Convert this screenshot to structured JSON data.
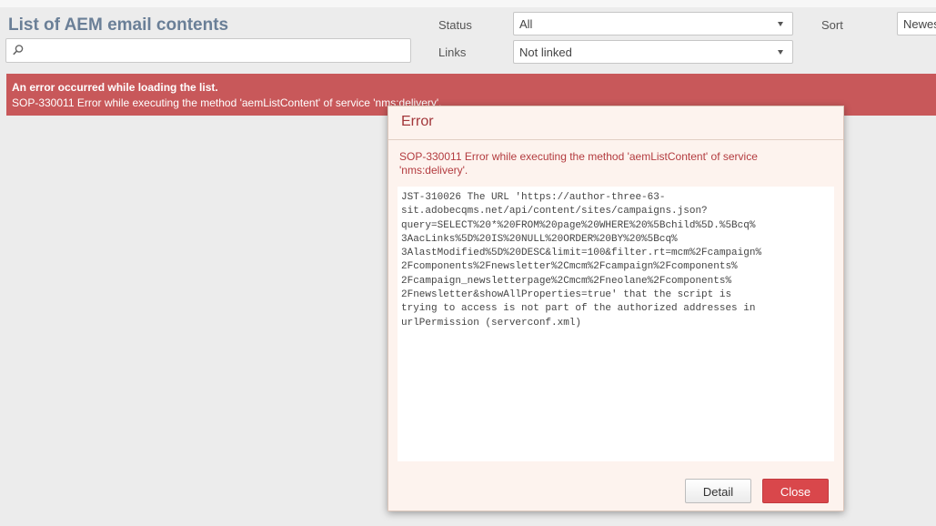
{
  "header": {
    "title": "List of AEM email contents",
    "search": {
      "value": "",
      "placeholder": ""
    }
  },
  "filters": {
    "status": {
      "label": "Status",
      "value": "All"
    },
    "links": {
      "label": "Links",
      "value": "Not linked"
    },
    "sort": {
      "label": "Sort",
      "value": "Newest"
    }
  },
  "error_banner": {
    "title": "An error occurred while loading the list.",
    "message": "SOP-330011 Error while executing the method 'aemListContent' of service 'nms:delivery'."
  },
  "dialog": {
    "title": "Error",
    "message": "SOP-330011 Error while executing the method 'aemListContent' of service 'nms:delivery'.",
    "detail": "JST-310026 The URL 'https://author-three-63-\nsit.adobecqms.net/api/content/sites/campaigns.json?\nquery=SELECT%20*%20FROM%20page%20WHERE%20%5Bchild%5D.%5Bcq%\n3AacLinks%5D%20IS%20NULL%20ORDER%20BY%20%5Bcq%\n3AlastModified%5D%20DESC&limit=100&filter.rt=mcm%2Fcampaign%\n2Fcomponents%2Fnewsletter%2Cmcm%2Fcampaign%2Fcomponents%\n2Fcampaign_newsletterpage%2Cmcm%2Fneolane%2Fcomponents%\n2Fnewsletter&showAllProperties=true' that the script is\ntrying to access is not part of the authorized addresses in\nurlPermission (serverconf.xml)",
    "buttons": {
      "detail": "Detail",
      "close": "Close"
    }
  },
  "colors": {
    "title": "#6a7f97",
    "error_banner": "#c8585a",
    "dialog_title": "#a2363a",
    "close_button": "#d9474b"
  }
}
